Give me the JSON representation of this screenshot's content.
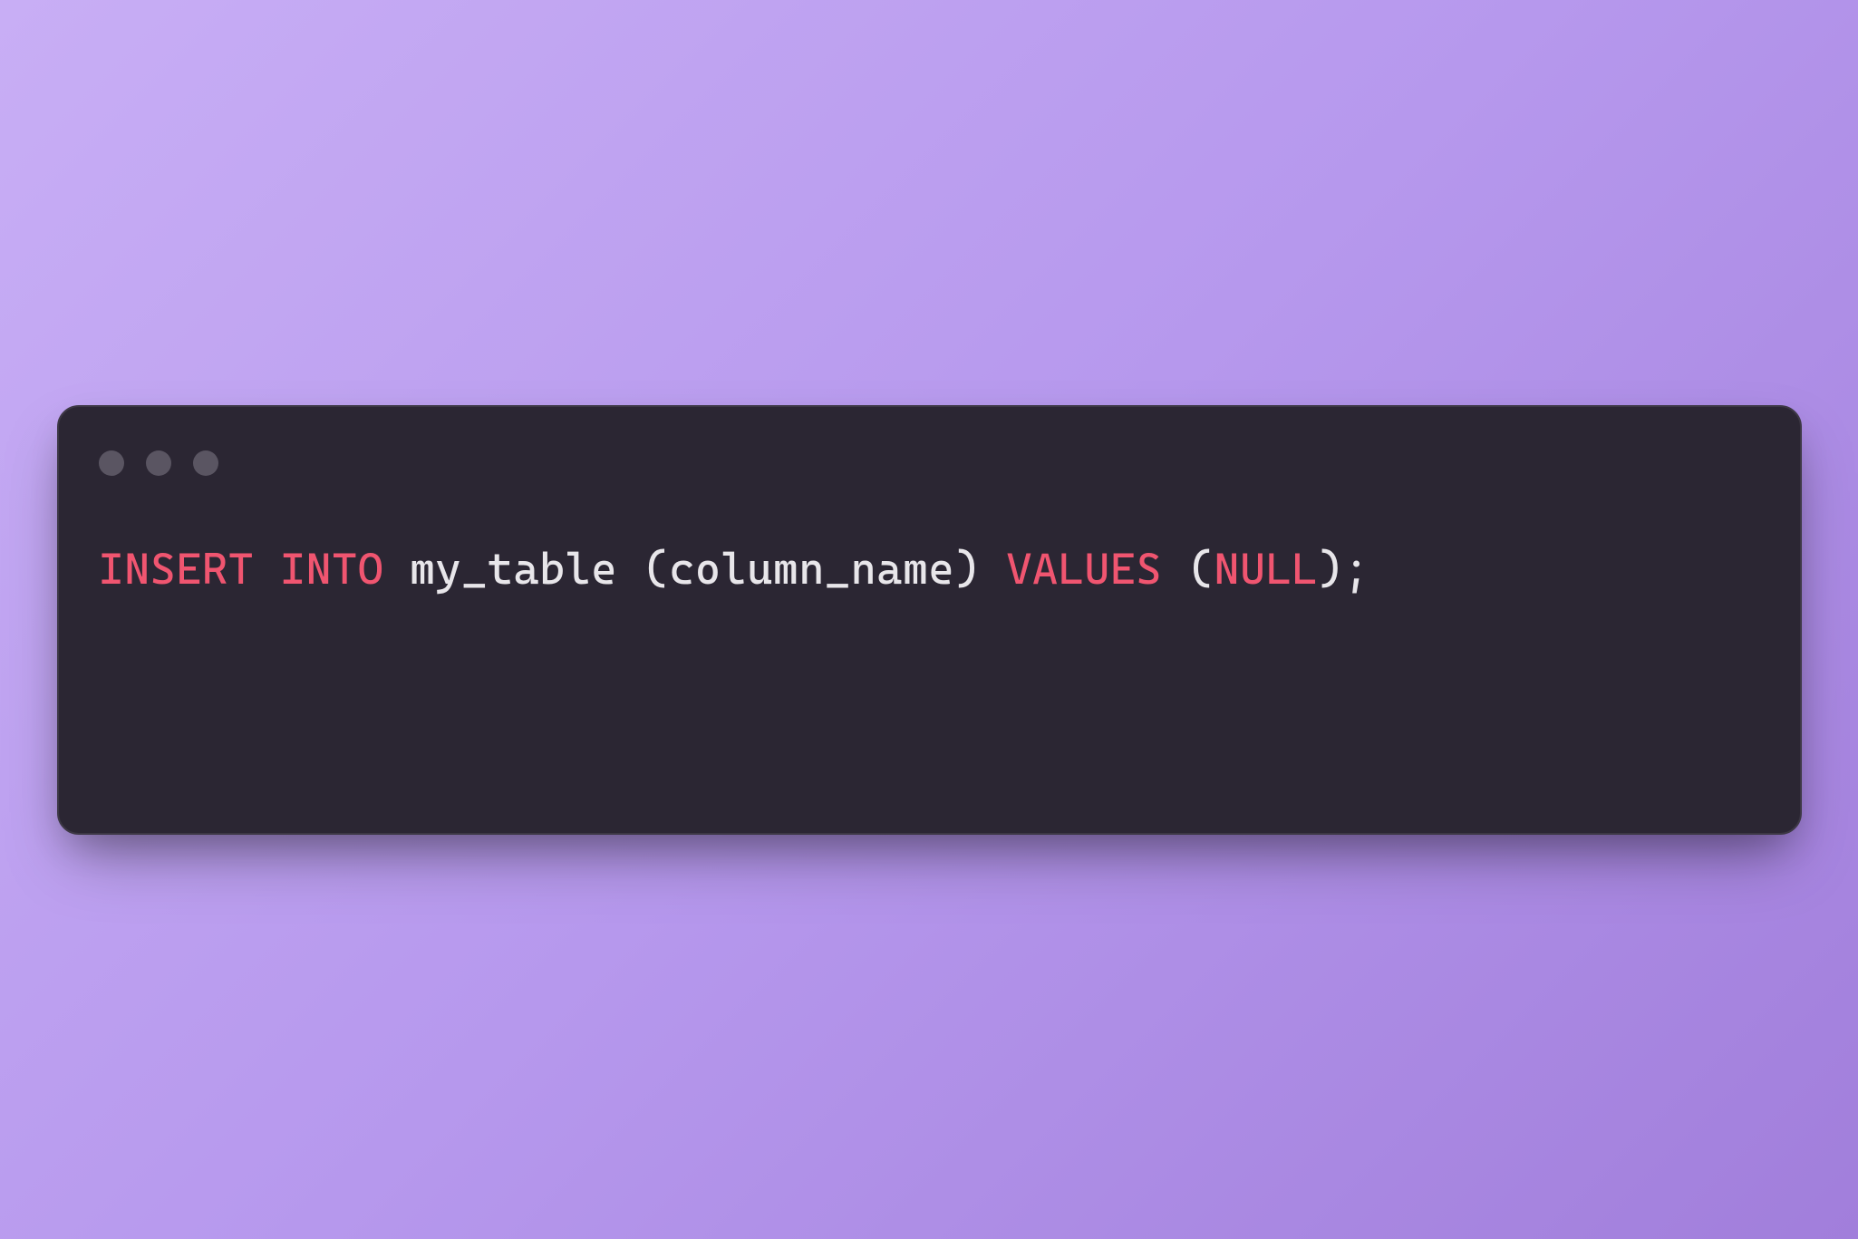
{
  "code": {
    "tokens": [
      {
        "text": "INSERT",
        "class": "keyword"
      },
      {
        "text": " ",
        "class": "identifier"
      },
      {
        "text": "INTO",
        "class": "keyword"
      },
      {
        "text": " my_table ",
        "class": "identifier"
      },
      {
        "text": "(",
        "class": "punctuation"
      },
      {
        "text": "column_name",
        "class": "identifier"
      },
      {
        "text": ")",
        "class": "punctuation"
      },
      {
        "text": " ",
        "class": "identifier"
      },
      {
        "text": "VALUES",
        "class": "keyword"
      },
      {
        "text": " ",
        "class": "identifier"
      },
      {
        "text": "(",
        "class": "punctuation"
      },
      {
        "text": "NULL",
        "class": "keyword"
      },
      {
        "text": ")",
        "class": "punctuation"
      },
      {
        "text": ";",
        "class": "punctuation"
      }
    ]
  }
}
